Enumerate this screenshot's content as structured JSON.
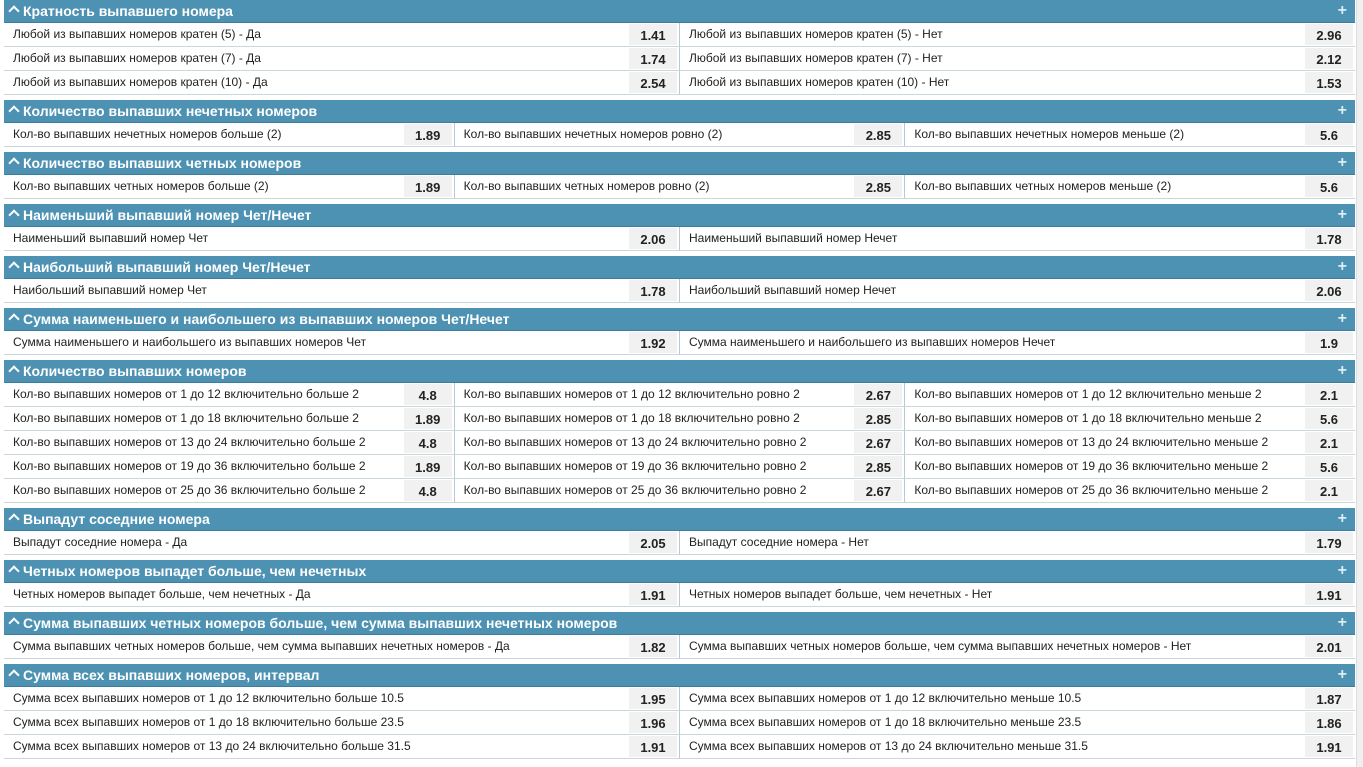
{
  "sections": [
    {
      "title": "Кратность выпавшего номера",
      "rows": [
        [
          {
            "label": "Любой из выпавших номеров кратен (5) - Да",
            "odd": "1.41"
          },
          {
            "label": "Любой из выпавших номеров кратен (5) - Нет",
            "odd": "2.96"
          }
        ],
        [
          {
            "label": "Любой из выпавших номеров кратен (7) - Да",
            "odd": "1.74"
          },
          {
            "label": "Любой из выпавших номеров кратен (7) - Нет",
            "odd": "2.12"
          }
        ],
        [
          {
            "label": "Любой из выпавших номеров кратен (10) - Да",
            "odd": "2.54"
          },
          {
            "label": "Любой из выпавших номеров кратен (10) - Нет",
            "odd": "1.53"
          }
        ]
      ]
    },
    {
      "title": "Количество выпавших нечетных номеров",
      "rows": [
        [
          {
            "label": "Кол-во выпавших нечетных номеров больше (2)",
            "odd": "1.89"
          },
          {
            "label": "Кол-во выпавших нечетных номеров ровно (2)",
            "odd": "2.85"
          },
          {
            "label": "Кол-во выпавших нечетных номеров меньше (2)",
            "odd": "5.6"
          }
        ]
      ]
    },
    {
      "title": "Количество выпавших четных номеров",
      "rows": [
        [
          {
            "label": "Кол-во выпавших четных номеров больше (2)",
            "odd": "1.89"
          },
          {
            "label": "Кол-во выпавших четных номеров ровно (2)",
            "odd": "2.85"
          },
          {
            "label": "Кол-во выпавших четных номеров меньше (2)",
            "odd": "5.6"
          }
        ]
      ]
    },
    {
      "title": "Наименьший выпавший номер Чет/Нечет",
      "rows": [
        [
          {
            "label": "Наименьший выпавший номер Чет",
            "odd": "2.06"
          },
          {
            "label": "Наименьший выпавший номер Нечет",
            "odd": "1.78"
          }
        ]
      ]
    },
    {
      "title": "Наибольший выпавший номер Чет/Нечет",
      "rows": [
        [
          {
            "label": "Наибольший выпавший номер Чет",
            "odd": "1.78"
          },
          {
            "label": "Наибольший выпавший номер Нечет",
            "odd": "2.06"
          }
        ]
      ]
    },
    {
      "title": "Сумма наименьшего и наибольшего из выпавших номеров Чет/Нечет",
      "rows": [
        [
          {
            "label": "Сумма наименьшего и наибольшего из выпавших номеров Чет",
            "odd": "1.92"
          },
          {
            "label": "Сумма наименьшего и наибольшего из выпавших номеров Нечет",
            "odd": "1.9"
          }
        ]
      ]
    },
    {
      "title": "Количество выпавших номеров",
      "rows": [
        [
          {
            "label": "Кол-во выпавших номеров от 1 до 12 включительно больше 2",
            "odd": "4.8"
          },
          {
            "label": "Кол-во выпавших номеров от 1 до 12 включительно ровно 2",
            "odd": "2.67"
          },
          {
            "label": "Кол-во выпавших номеров от 1 до 12 включительно меньше 2",
            "odd": "2.1"
          }
        ],
        [
          {
            "label": "Кол-во выпавших номеров от 1 до 18 включительно больше 2",
            "odd": "1.89"
          },
          {
            "label": "Кол-во выпавших номеров от 1 до 18 включительно ровно 2",
            "odd": "2.85"
          },
          {
            "label": "Кол-во выпавших номеров от 1 до 18 включительно меньше 2",
            "odd": "5.6"
          }
        ],
        [
          {
            "label": "Кол-во выпавших номеров от 13 до 24 включительно больше 2",
            "odd": "4.8"
          },
          {
            "label": "Кол-во выпавших номеров от 13 до 24 включительно ровно 2",
            "odd": "2.67"
          },
          {
            "label": "Кол-во выпавших номеров от 13 до 24 включительно меньше 2",
            "odd": "2.1"
          }
        ],
        [
          {
            "label": "Кол-во выпавших номеров от 19 до 36 включительно больше 2",
            "odd": "1.89"
          },
          {
            "label": "Кол-во выпавших номеров от 19 до 36 включительно ровно 2",
            "odd": "2.85"
          },
          {
            "label": "Кол-во выпавших номеров от 19 до 36 включительно меньше 2",
            "odd": "5.6"
          }
        ],
        [
          {
            "label": "Кол-во выпавших номеров от 25 до 36 включительно больше 2",
            "odd": "4.8"
          },
          {
            "label": "Кол-во выпавших номеров от 25 до 36 включительно ровно 2",
            "odd": "2.67"
          },
          {
            "label": "Кол-во выпавших номеров от 25 до 36 включительно меньше 2",
            "odd": "2.1"
          }
        ]
      ]
    },
    {
      "title": "Выпадут соседние номера",
      "rows": [
        [
          {
            "label": "Выпадут соседние номера - Да",
            "odd": "2.05"
          },
          {
            "label": "Выпадут соседние номера - Нет",
            "odd": "1.79"
          }
        ]
      ]
    },
    {
      "title": "Четных номеров выпадет больше, чем нечетных",
      "rows": [
        [
          {
            "label": "Четных номеров выпадет больше, чем нечетных - Да",
            "odd": "1.91"
          },
          {
            "label": "Четных номеров выпадет больше, чем нечетных - Нет",
            "odd": "1.91"
          }
        ]
      ]
    },
    {
      "title": "Сумма выпавших четных номеров больше, чем сумма выпавших нечетных номеров",
      "rows": [
        [
          {
            "label": "Сумма выпавших четных номеров больше, чем сумма выпавших нечетных номеров - Да",
            "odd": "1.82"
          },
          {
            "label": "Сумма выпавших четных номеров больше, чем сумма выпавших нечетных номеров - Нет",
            "odd": "2.01"
          }
        ]
      ]
    },
    {
      "title": "Сумма всех выпавших номеров, интервал",
      "rows": [
        [
          {
            "label": "Сумма всех выпавших номеров от 1 до 12 включительно больше 10.5",
            "odd": "1.95"
          },
          {
            "label": "Сумма всех выпавших номеров от 1 до 12 включительно меньше 10.5",
            "odd": "1.87"
          }
        ],
        [
          {
            "label": "Сумма всех выпавших номеров от 1 до 18 включительно больше 23.5",
            "odd": "1.96"
          },
          {
            "label": "Сумма всех выпавших номеров от 1 до 18 включительно меньше 23.5",
            "odd": "1.86"
          }
        ],
        [
          {
            "label": "Сумма всех выпавших номеров от 13 до 24 включительно больше 31.5",
            "odd": "1.91"
          },
          {
            "label": "Сумма всех выпавших номеров от 13 до 24 включительно меньше 31.5",
            "odd": "1.91"
          }
        ]
      ]
    }
  ],
  "icons": {
    "collapse": "chevron-up-icon",
    "expand": "plus-icon"
  },
  "colors": {
    "header_bg": "#4e92b3",
    "odd_bg": "#f1f1f1"
  }
}
